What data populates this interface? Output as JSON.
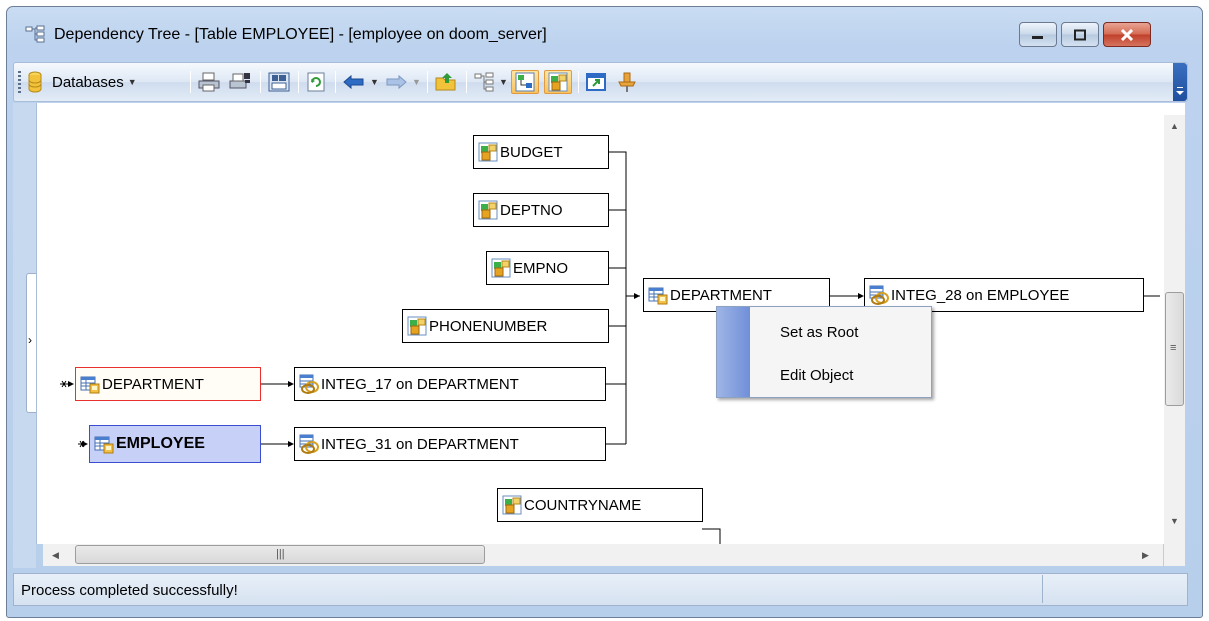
{
  "window": {
    "title": "Dependency Tree - [Table EMPLOYEE] - [employee on doom_server]"
  },
  "toolbar": {
    "databases_label": "Databases"
  },
  "tree": {
    "budget": "BUDGET",
    "deptno": "DEPTNO",
    "empno": "EMPNO",
    "phonenumber": "PHONENUMBER",
    "department_left": "DEPARTMENT",
    "integ17": "INTEG_17 on DEPARTMENT",
    "employee": "EMPLOYEE",
    "integ31": "INTEG_31 on DEPARTMENT",
    "department_mid": "DEPARTMENT",
    "integ28": "INTEG_28 on EMPLOYEE",
    "countryname": "COUNTRYNAME"
  },
  "context_menu": {
    "items": [
      "Set as Root",
      "Edit Object"
    ]
  },
  "status": {
    "message": "Process completed successfully!"
  },
  "icons": {
    "table": "table-icon",
    "field": "field-icon",
    "constraint": "constraint-icon"
  },
  "colors": {
    "selected_border": "#3a4fd0",
    "root_border": "#e8312c",
    "titlebar": "#bcd2ee"
  }
}
